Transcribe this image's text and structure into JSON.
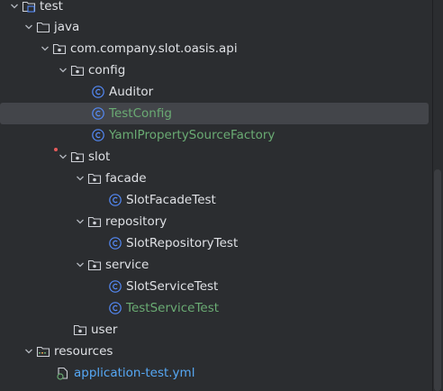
{
  "tree": {
    "root": {
      "label": "test"
    },
    "java": {
      "label": "java"
    },
    "package": {
      "label": "com.company.slot.oasis.api"
    },
    "config": {
      "label": "config"
    },
    "auditor": {
      "label": "Auditor"
    },
    "test_config": {
      "label": "TestConfig"
    },
    "yaml_factory": {
      "label": "YamlPropertySourceFactory"
    },
    "slot": {
      "label": "slot"
    },
    "facade": {
      "label": "facade"
    },
    "slot_facade_test": {
      "label": "SlotFacadeTest"
    },
    "repository": {
      "label": "repository"
    },
    "slot_repository_test": {
      "label": "SlotRepositoryTest"
    },
    "service": {
      "label": "service"
    },
    "slot_service_test": {
      "label": "SlotServiceTest"
    },
    "test_service_test": {
      "label": "TestServiceTest"
    },
    "user": {
      "label": "user"
    },
    "resources": {
      "label": "resources"
    },
    "application_test_yml": {
      "label": "application-test.yml"
    }
  },
  "icons": {
    "folder": "folder-icon",
    "package": "package-icon",
    "class": "class-icon",
    "resources": "resources-folder-icon",
    "yaml": "yaml-file-icon",
    "test_root": "test-root-folder-icon"
  },
  "colors": {
    "background": "#2b2d30",
    "selection": "#43454a",
    "text": "#dfe1e5",
    "added_green": "#6aab73",
    "modified_blue": "#56a8f5",
    "class_icon": "#548af7"
  }
}
